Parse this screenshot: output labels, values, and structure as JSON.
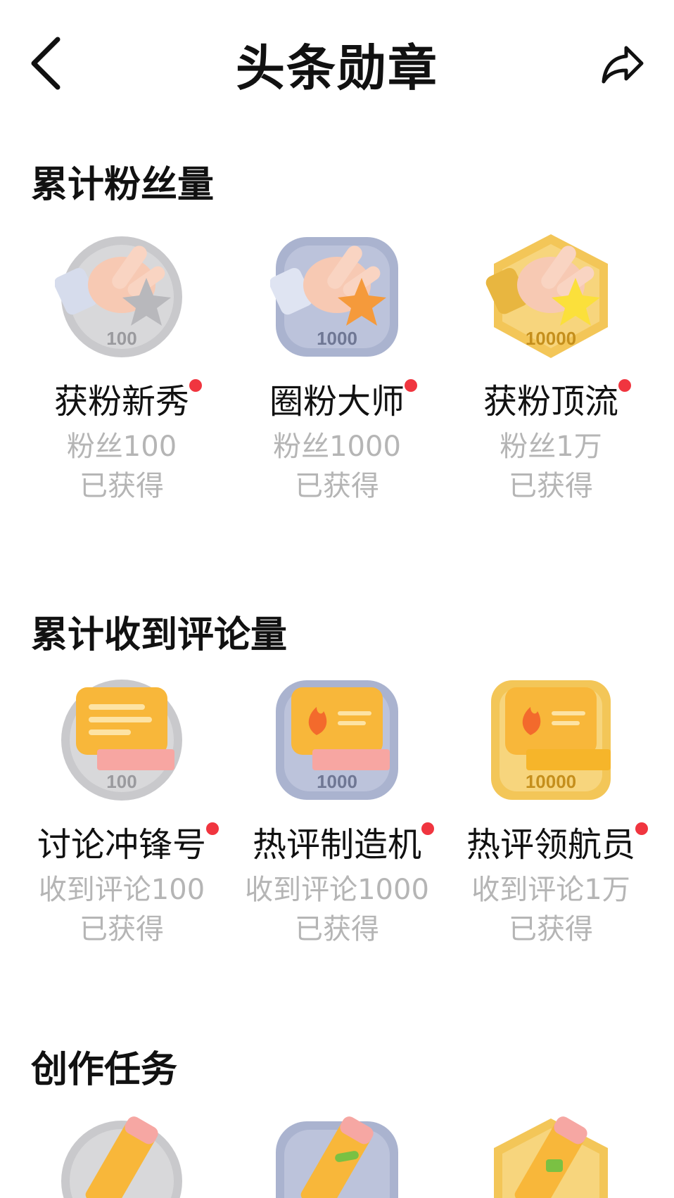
{
  "header": {
    "title": "头条勋章",
    "back_icon": "chevron-left-icon",
    "share_icon": "share-icon"
  },
  "colors": {
    "silver": "#c9c9cc",
    "blue": "#aab3cf",
    "gold": "#f3c658",
    "red_dot": "#f0353f",
    "gray_text": "#b5b5b5"
  },
  "sections": [
    {
      "title": "累计粉丝量",
      "badges": [
        {
          "name": "获粉新秀",
          "condition": "粉丝100",
          "status": "已获得",
          "medal_number": "100",
          "tier": "silver",
          "icon": "hand-star-icon"
        },
        {
          "name": "圈粉大师",
          "condition": "粉丝1000",
          "status": "已获得",
          "medal_number": "1000",
          "tier": "blue",
          "icon": "hand-star-icon"
        },
        {
          "name": "获粉顶流",
          "condition": "粉丝1万",
          "status": "已获得",
          "medal_number": "10000",
          "tier": "gold",
          "icon": "hand-star-icon"
        }
      ]
    },
    {
      "title": "累计收到评论量",
      "badges": [
        {
          "name": "讨论冲锋号",
          "condition": "收到评论100",
          "status": "已获得",
          "medal_number": "100",
          "tier": "silver",
          "icon": "comment-bubble-icon"
        },
        {
          "name": "热评制造机",
          "condition": "收到评论1000",
          "status": "已获得",
          "medal_number": "1000",
          "tier": "blue",
          "icon": "comment-fire-icon"
        },
        {
          "name": "热评领航员",
          "condition": "收到评论1万",
          "status": "已获得",
          "medal_number": "10000",
          "tier": "gold",
          "icon": "comment-fire-icon"
        }
      ]
    },
    {
      "title": "创作任务",
      "badges": [
        {
          "tier": "silver",
          "icon": "pencil-icon"
        },
        {
          "tier": "blue",
          "icon": "pencil-icon"
        },
        {
          "tier": "gold",
          "icon": "pencil-icon"
        }
      ]
    }
  ]
}
